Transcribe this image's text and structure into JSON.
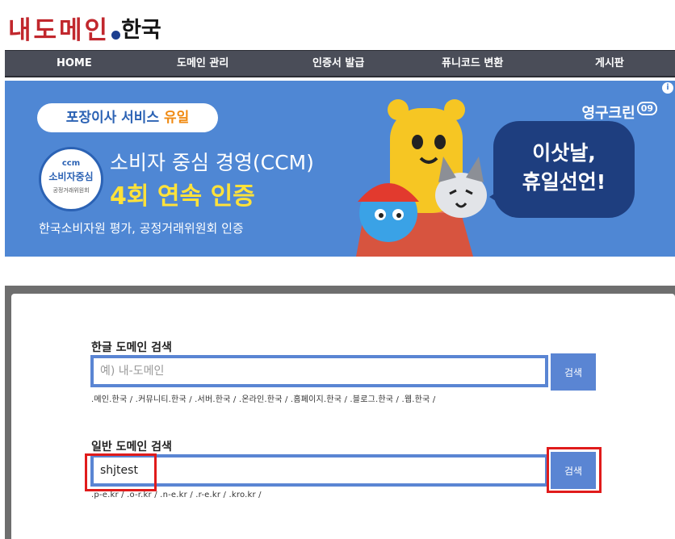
{
  "logo": {
    "main": "내도메인",
    "sub": "한국"
  },
  "nav": {
    "items": [
      {
        "label": "HOME"
      },
      {
        "label": "도메인 관리"
      },
      {
        "label": "인증서 발급"
      },
      {
        "label": "퓨니코드 변환"
      },
      {
        "label": "게시판"
      }
    ]
  },
  "banner": {
    "pill_text": "포장이사 서비스 ",
    "pill_highlight": "유일",
    "badge_top": "ccm",
    "badge_mid": "소비자중심",
    "badge_bottom": "공정거래위원회",
    "line1": "소비자 중심 경영(CCM)",
    "line2": "4회 연속 인증",
    "line3": "한국소비자원 평가, 공정거래위원회 인증",
    "brand": "영구크린",
    "brand_num": "09",
    "bubble_line1": "이삿날,",
    "bubble_line2": "휴일선언!"
  },
  "korean_search": {
    "label": "한글 도메인 검색",
    "placeholder": "예) 내-도메인",
    "value": "",
    "button": "검색",
    "hint": ".메인.한국 / .커뮤니티.한국 / .서버.한국 / .온라인.한국 / .홈페이지.한국 / .블로그.한국 / .웹.한국 /"
  },
  "general_search": {
    "label": "일반 도메인 검색",
    "placeholder": "",
    "value": "shjtest",
    "button": "검색",
    "hint": ".p-e.kr / .o-r.kr / .n-e.kr / .r-e.kr / .kro.kr /"
  },
  "colors": {
    "nav_bg": "#4a4d58",
    "accent": "#5a85d3",
    "banner_bg": "#4f87d4",
    "highlight_red": "#e01b1b"
  }
}
